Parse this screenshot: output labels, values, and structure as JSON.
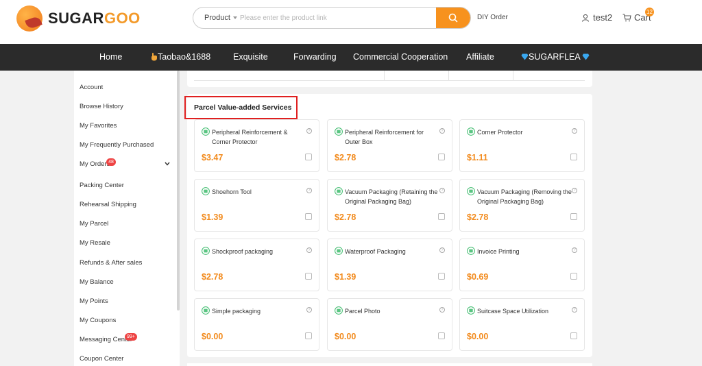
{
  "brand": {
    "name_a": "SUGAR",
    "name_b": "GOO"
  },
  "search": {
    "type": "Product",
    "placeholder": "Please enter the product link"
  },
  "header": {
    "diy_order": "DIY Order",
    "username": "test2",
    "cart_label": "Cart",
    "cart_count": "12"
  },
  "nav": {
    "items": [
      "Home",
      "Taobao&1688",
      "Exquisite",
      "Forwarding",
      "Commercial Cooperation",
      "Affiliate",
      "SUGARFLEA"
    ]
  },
  "sidebar": {
    "items": [
      "Account",
      "Browse History",
      "My Favorites",
      "My Frequently Purchased",
      "My Orders",
      "Packing Center",
      "Rehearsal Shipping",
      "My Parcel",
      "My Resale",
      "Refunds & After sales",
      "My Balance",
      "My Points",
      "My Coupons",
      "Messaging Center",
      "Coupon Center"
    ],
    "orders_badge": "48",
    "messaging_badge": "99+"
  },
  "services": {
    "title": "Parcel Value-added Services",
    "tiles": [
      {
        "name": "Peripheral Reinforcement & Corner Protector",
        "price": "$3.47",
        "icon": "box-icon"
      },
      {
        "name": "Peripheral Reinforcement for Outer Box",
        "price": "$2.78",
        "icon": "box-icon"
      },
      {
        "name": "Corner Protector",
        "price": "$1.11",
        "icon": "box-icon"
      },
      {
        "name": "Shoehorn Tool",
        "price": "$1.39",
        "icon": "shoehorn-icon"
      },
      {
        "name": "Vacuum Packaging (Retaining the Original Packaging Bag)",
        "price": "$2.78",
        "icon": "vacuum-bag-icon"
      },
      {
        "name": "Vacuum Packaging (Removing the Original Packaging Bag)",
        "price": "$2.78",
        "icon": "vacuum-bag-icon"
      },
      {
        "name": "Shockproof packaging",
        "price": "$2.78",
        "icon": "shockproof-icon"
      },
      {
        "name": "Waterproof Packaging",
        "price": "$1.39",
        "icon": "waterproof-icon"
      },
      {
        "name": "Invoice Printing",
        "price": "$0.69",
        "icon": "printer-icon"
      },
      {
        "name": "Simple packaging",
        "price": "$0.00",
        "icon": "package-icon"
      },
      {
        "name": "Parcel Photo",
        "price": "$0.00",
        "icon": "photo-icon"
      },
      {
        "name": "Suitcase Space Utilization",
        "price": "$0.00",
        "icon": "suitcase-icon"
      }
    ]
  },
  "colors": {
    "accent": "#f7921e",
    "icon_green": "#3dbb6c",
    "highlight_red": "#e02020",
    "nav_bg": "#2b2b2b"
  }
}
